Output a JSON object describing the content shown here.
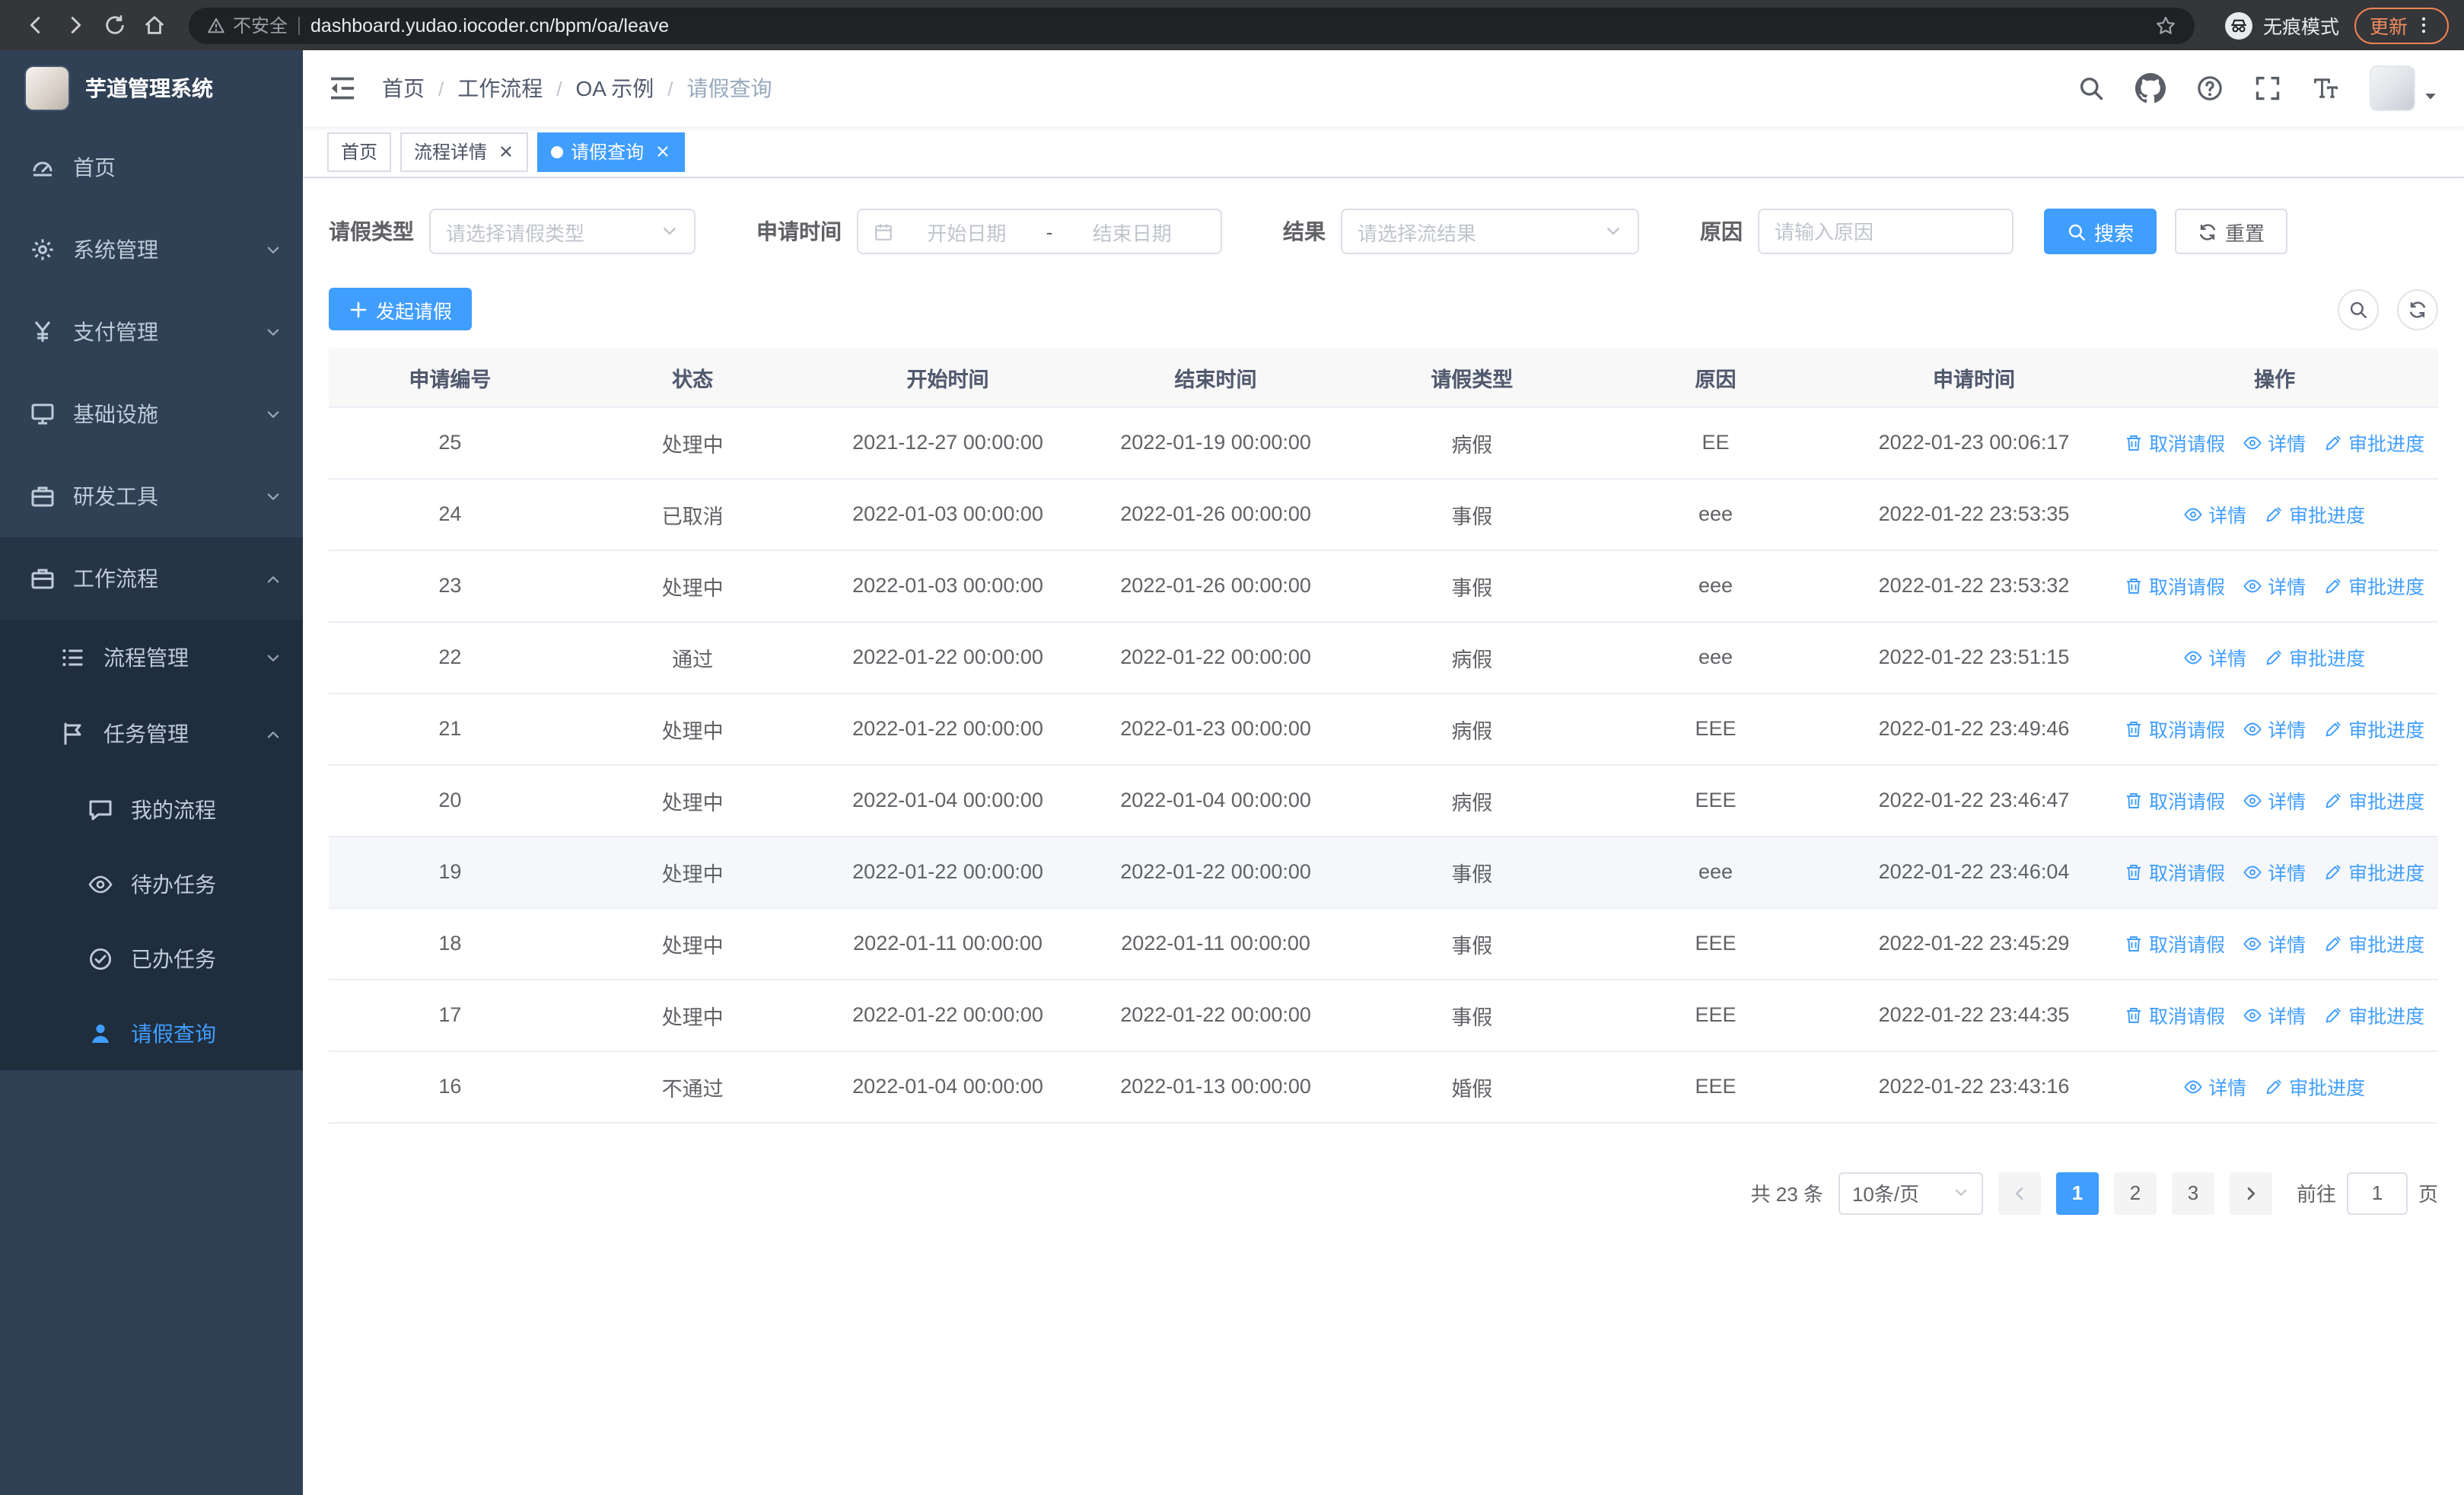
{
  "browser": {
    "security_label": "不安全",
    "url": "dashboard.yudao.iocoder.cn/bpm/oa/leave",
    "incognito_label": "无痕模式",
    "update_label": "更新"
  },
  "sidebar": {
    "title": "芋道管理系统",
    "items": [
      {
        "label": "首页"
      },
      {
        "label": "系统管理"
      },
      {
        "label": "支付管理"
      },
      {
        "label": "基础设施"
      },
      {
        "label": "研发工具"
      },
      {
        "label": "工作流程"
      },
      {
        "label": "流程管理"
      },
      {
        "label": "任务管理"
      },
      {
        "label": "我的流程"
      },
      {
        "label": "待办任务"
      },
      {
        "label": "已办任务"
      },
      {
        "label": "请假查询"
      }
    ]
  },
  "breadcrumb": [
    "首页",
    "工作流程",
    "OA 示例",
    "请假查询"
  ],
  "tabs": [
    {
      "label": "首页"
    },
    {
      "label": "流程详情"
    },
    {
      "label": "请假查询"
    }
  ],
  "filters": {
    "leave_type_label": "请假类型",
    "leave_type_placeholder": "请选择请假类型",
    "apply_time_label": "申请时间",
    "start_placeholder": "开始日期",
    "range_separator": "-",
    "end_placeholder": "结束日期",
    "result_label": "结果",
    "result_placeholder": "请选择流结果",
    "reason_label": "原因",
    "reason_placeholder": "请输入原因",
    "search_label": "搜索",
    "reset_label": "重置"
  },
  "toolbar": {
    "create_label": "发起请假"
  },
  "table": {
    "headers": [
      "申请编号",
      "状态",
      "开始时间",
      "结束时间",
      "请假类型",
      "原因",
      "申请时间",
      "操作"
    ],
    "action_labels": {
      "cancel": "取消请假",
      "detail": "详情",
      "progress": "审批进度"
    },
    "rows": [
      {
        "id": "25",
        "status": "处理中",
        "start": "2021-12-27 00:00:00",
        "end": "2022-01-19 00:00:00",
        "type": "病假",
        "reason": "EE",
        "apply_time": "2022-01-23 00:06:17",
        "actions": [
          "cancel",
          "detail",
          "progress"
        ]
      },
      {
        "id": "24",
        "status": "已取消",
        "start": "2022-01-03 00:00:00",
        "end": "2022-01-26 00:00:00",
        "type": "事假",
        "reason": "eee",
        "apply_time": "2022-01-22 23:53:35",
        "actions": [
          "detail",
          "progress"
        ]
      },
      {
        "id": "23",
        "status": "处理中",
        "start": "2022-01-03 00:00:00",
        "end": "2022-01-26 00:00:00",
        "type": "事假",
        "reason": "eee",
        "apply_time": "2022-01-22 23:53:32",
        "actions": [
          "cancel",
          "detail",
          "progress"
        ]
      },
      {
        "id": "22",
        "status": "通过",
        "start": "2022-01-22 00:00:00",
        "end": "2022-01-22 00:00:00",
        "type": "病假",
        "reason": "eee",
        "apply_time": "2022-01-22 23:51:15",
        "actions": [
          "detail",
          "progress"
        ]
      },
      {
        "id": "21",
        "status": "处理中",
        "start": "2022-01-22 00:00:00",
        "end": "2022-01-23 00:00:00",
        "type": "病假",
        "reason": "EEE",
        "apply_time": "2022-01-22 23:49:46",
        "actions": [
          "cancel",
          "detail",
          "progress"
        ]
      },
      {
        "id": "20",
        "status": "处理中",
        "start": "2022-01-04 00:00:00",
        "end": "2022-01-04 00:00:00",
        "type": "病假",
        "reason": "EEE",
        "apply_time": "2022-01-22 23:46:47",
        "actions": [
          "cancel",
          "detail",
          "progress"
        ]
      },
      {
        "id": "19",
        "status": "处理中",
        "start": "2022-01-22 00:00:00",
        "end": "2022-01-22 00:00:00",
        "type": "事假",
        "reason": "eee",
        "apply_time": "2022-01-22 23:46:04",
        "actions": [
          "cancel",
          "detail",
          "progress"
        ],
        "highlight": true
      },
      {
        "id": "18",
        "status": "处理中",
        "start": "2022-01-11 00:00:00",
        "end": "2022-01-11 00:00:00",
        "type": "事假",
        "reason": "EEE",
        "apply_time": "2022-01-22 23:45:29",
        "actions": [
          "cancel",
          "detail",
          "progress"
        ]
      },
      {
        "id": "17",
        "status": "处理中",
        "start": "2022-01-22 00:00:00",
        "end": "2022-01-22 00:00:00",
        "type": "事假",
        "reason": "EEE",
        "apply_time": "2022-01-22 23:44:35",
        "actions": [
          "cancel",
          "detail",
          "progress"
        ]
      },
      {
        "id": "16",
        "status": "不通过",
        "start": "2022-01-04 00:00:00",
        "end": "2022-01-13 00:00:00",
        "type": "婚假",
        "reason": "EEE",
        "apply_time": "2022-01-22 23:43:16",
        "actions": [
          "detail",
          "progress"
        ]
      }
    ]
  },
  "pagination": {
    "total_label": "共 23 条",
    "page_size_label": "10条/页",
    "pages": [
      "1",
      "2",
      "3"
    ],
    "current_page": "1",
    "goto_prefix": "前往",
    "goto_value": "1",
    "goto_suffix": "页"
  },
  "colors": {
    "primary": "#409eff",
    "sidebar_bg": "#304156",
    "sidebar_sub_bg": "#1f2d3d",
    "tag_active": "#409eff"
  }
}
